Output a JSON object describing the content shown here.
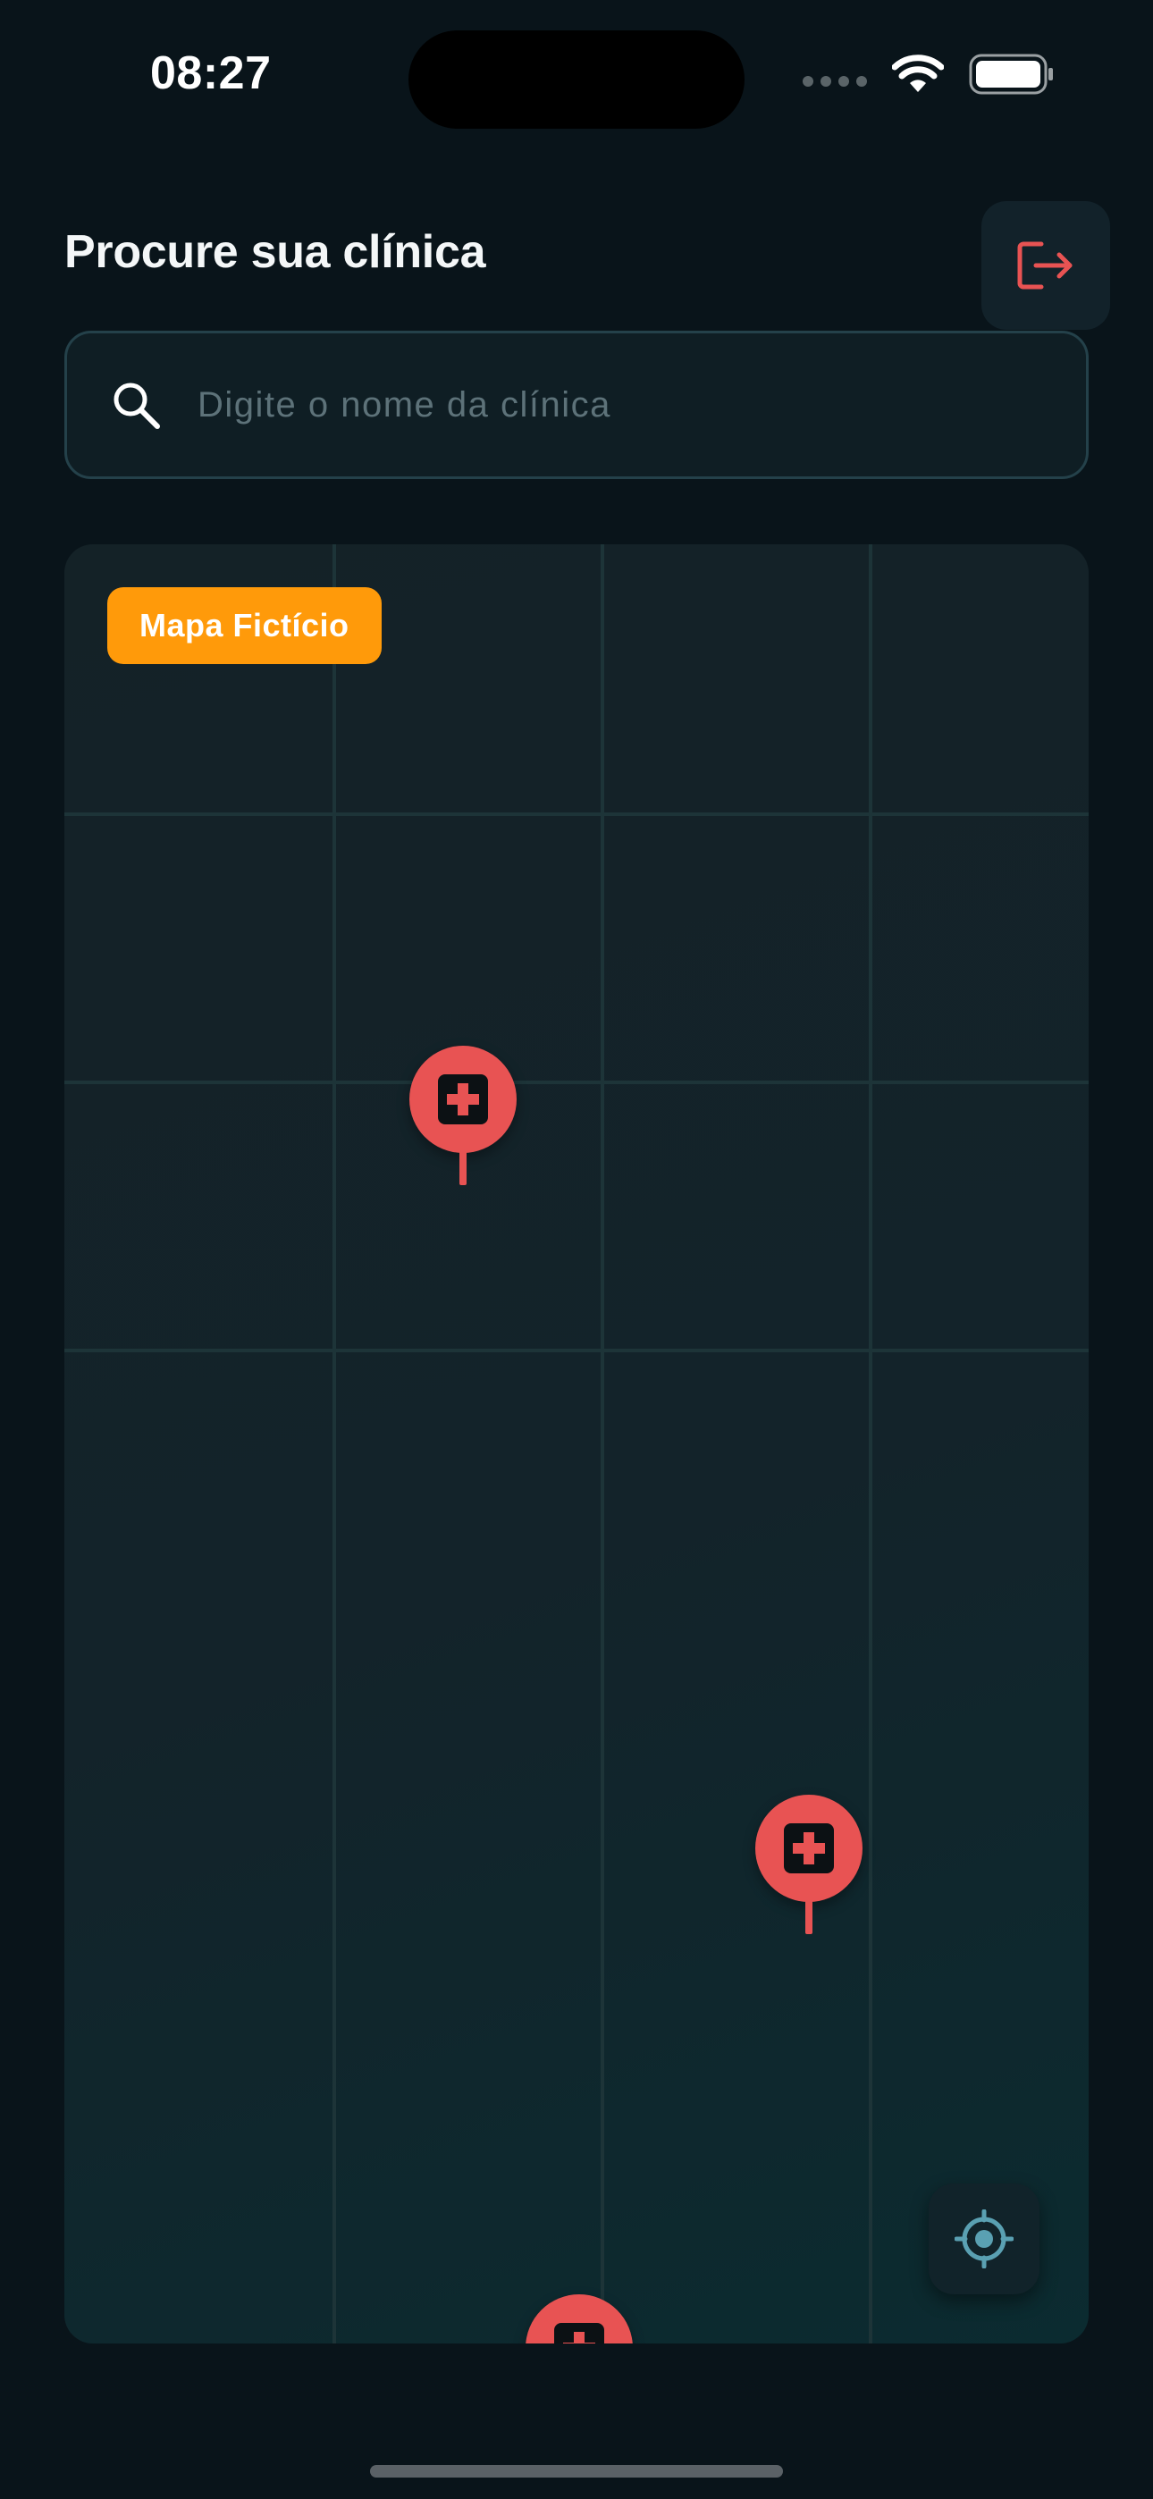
{
  "status_bar": {
    "time": "08:27",
    "icons": [
      "signal-dots-icon",
      "wifi-icon",
      "battery-icon"
    ]
  },
  "header": {
    "title": "Procure sua clínica",
    "logout_icon": "logout-icon",
    "colors": {
      "logout_accent": "#e85353"
    }
  },
  "search": {
    "placeholder": "Digite o nome da clínica",
    "value": "",
    "icon": "search-icon"
  },
  "map": {
    "badge_label": "Mapa Fictício",
    "badge_color": "#ff9a0a",
    "pin_color": "#e85353",
    "pin_icon": "medical-cross-icon",
    "pin_count": 3,
    "locate_icon": "crosshair-icon"
  }
}
